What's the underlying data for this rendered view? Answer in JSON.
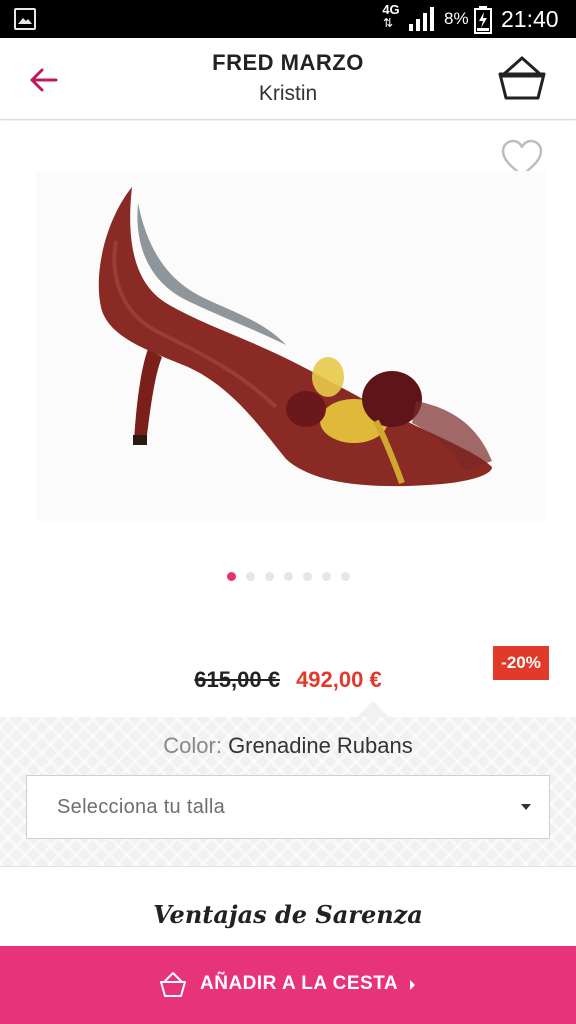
{
  "status_bar": {
    "network": "4G",
    "network_arrows": "⇅",
    "battery": "8%",
    "time": "21:40"
  },
  "header": {
    "brand": "FRED MARZO",
    "model": "Kristin"
  },
  "product": {
    "image_icon": "shoe-product-image",
    "carousel": {
      "total": 7,
      "active_index": 0
    },
    "discount_badge": "-20%",
    "old_price": "615,00 €",
    "new_price": "492,00 €",
    "color_label": "Color:",
    "color_value": "Grenadine Rubans",
    "size_placeholder": "Selecciona tu talla"
  },
  "advantages": {
    "title": "Ventajas de Sarenza"
  },
  "cta": {
    "label": "AÑADIR A LA CESTA"
  },
  "colors": {
    "accent": "#e6337a",
    "price_red": "#e23a2a",
    "status_bar": "#000000"
  }
}
